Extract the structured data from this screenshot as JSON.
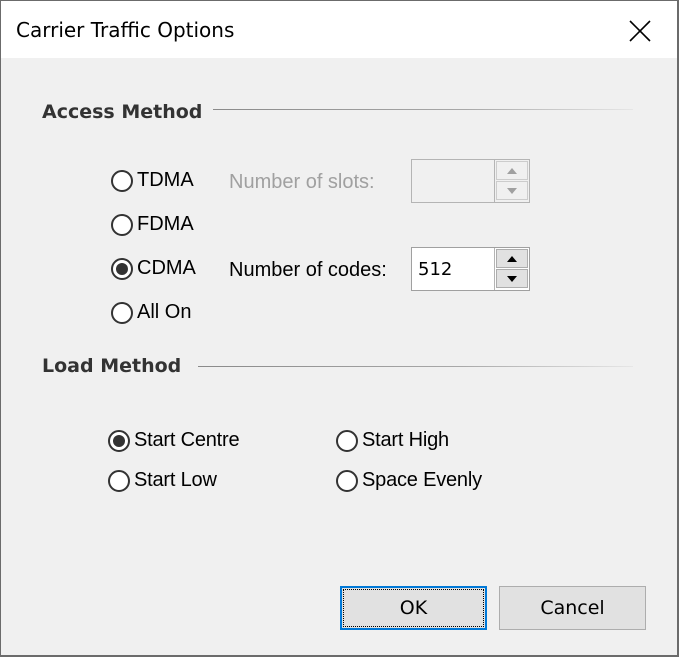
{
  "window": {
    "title": "Carrier Traffic Options",
    "close_icon": "close-icon"
  },
  "access_method": {
    "header": "Access Method",
    "options": [
      {
        "label": "TDMA",
        "checked": false
      },
      {
        "label": "FDMA",
        "checked": false
      },
      {
        "label": "CDMA",
        "checked": true
      },
      {
        "label": "All On",
        "checked": false
      }
    ],
    "slots": {
      "label": "Number of slots:",
      "value": "",
      "enabled": false
    },
    "codes": {
      "label": "Number of codes:",
      "value": "512",
      "enabled": true
    }
  },
  "load_method": {
    "header": "Load Method",
    "options": [
      {
        "label": "Start Centre",
        "checked": true
      },
      {
        "label": "Start High",
        "checked": false
      },
      {
        "label": "Start Low",
        "checked": false
      },
      {
        "label": "Space Evenly",
        "checked": false
      }
    ]
  },
  "buttons": {
    "ok": "OK",
    "cancel": "Cancel"
  },
  "colors": {
    "focus_border": "#0078d7",
    "dialog_bg": "#f0f0f0",
    "titlebar_bg": "#ffffff"
  }
}
